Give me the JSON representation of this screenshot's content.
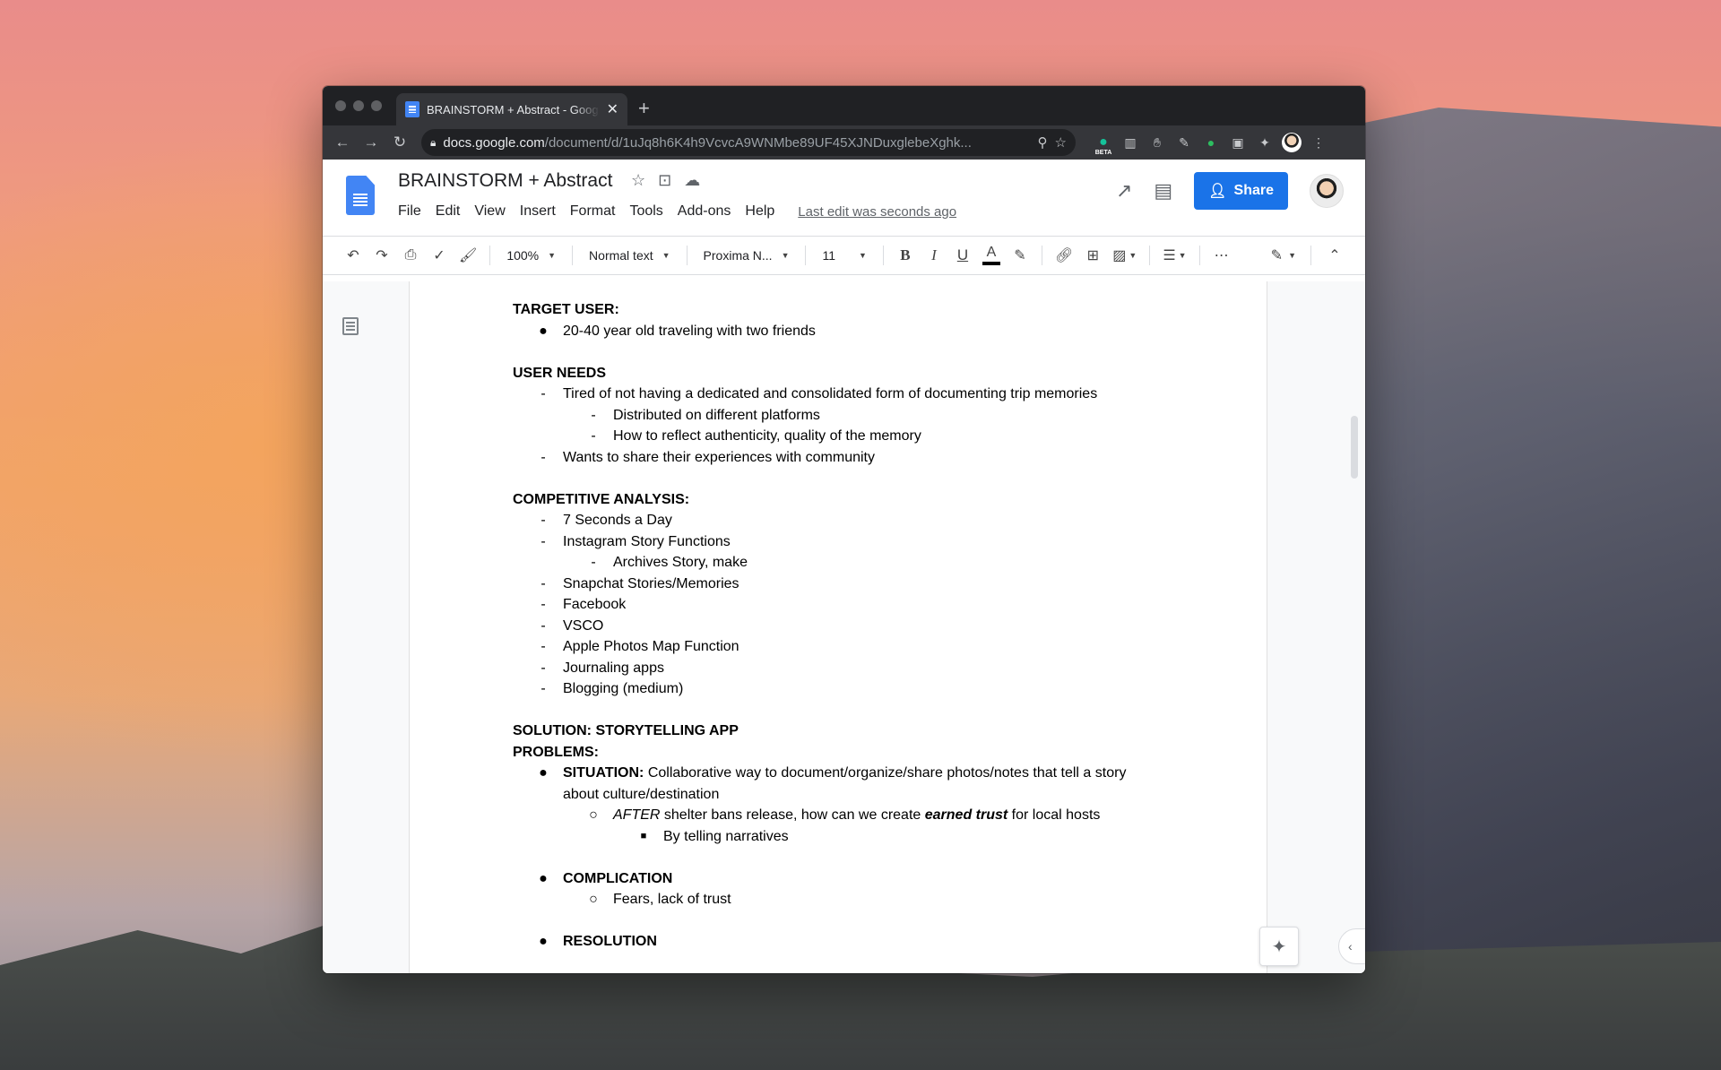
{
  "browser": {
    "tab_title": "BRAINSTORM + Abstract - Google Docs",
    "new_tab_glyph": "+",
    "url_host": "docs.google.com",
    "url_path": "/document/d/1uJq8h6K4h9VcvcA9WNMbe89UF45XJNDuxglebeXghk...",
    "ext_beta_label": "BETA"
  },
  "docs": {
    "title": "BRAINSTORM + Abstract",
    "menu": [
      "File",
      "Edit",
      "View",
      "Insert",
      "Format",
      "Tools",
      "Add-ons",
      "Help"
    ],
    "last_edit": "Last edit was seconds ago",
    "share_label": "Share"
  },
  "toolbar": {
    "zoom": "100%",
    "style": "Normal text",
    "font": "Proxima N...",
    "size": "11",
    "bold": "B",
    "italic": "I",
    "underline": "U",
    "text_color": "A"
  },
  "document": {
    "target_user_heading": "TARGET USER:",
    "target_user_1": "20-40 year old traveling with two friends",
    "user_needs_heading": "USER NEEDS",
    "user_needs_1": "Tired of not having a dedicated and consolidated form of documenting trip memories",
    "user_needs_1a": "Distributed on different platforms",
    "user_needs_1b": "How to reflect authenticity, quality of the memory",
    "user_needs_2": "Wants to share their experiences with community",
    "competitive_heading": "COMPETITIVE ANALYSIS:",
    "comp_1": "7 Seconds a Day",
    "comp_2": "Instagram Story Functions",
    "comp_2a": "Archives Story, make",
    "comp_3": "Snapchat Stories/Memories",
    "comp_4": "Facebook",
    "comp_5": "VSCO",
    "comp_6": "Apple Photos Map Function",
    "comp_7": "Journaling apps",
    "comp_8": "Blogging (medium)",
    "solution_heading": "SOLUTION: STORYTELLING APP",
    "problems_heading": "PROBLEMS:",
    "situation_label": "SITUATION:",
    "situation_text": "Collaborative way to document/organize/share photos/notes that tell a story about culture/destination",
    "after_label": "AFTER",
    "after_text_1": "shelter bans release, how can we create",
    "after_emph": "earned trust",
    "after_text_2": "for local hosts",
    "narratives": "By telling narratives",
    "complication_label": "COMPLICATION",
    "complication_1": "Fears, lack of trust",
    "resolution_label": "RESOLUTION"
  },
  "markers": {
    "bullet": "●",
    "dash": "-",
    "circle": "○",
    "square": "■"
  },
  "colors": {
    "share_blue": "#1a73e8",
    "docs_blue": "#4285f4",
    "chrome_dark": "#35363a"
  }
}
